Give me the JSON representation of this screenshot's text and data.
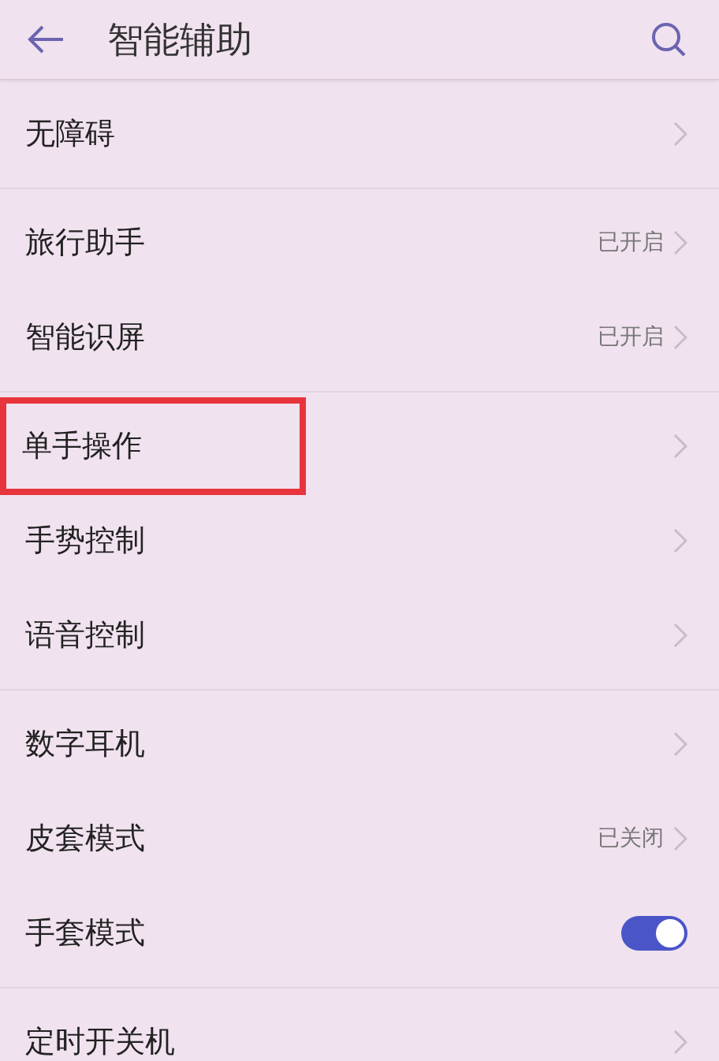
{
  "header": {
    "title": "智能辅助"
  },
  "groups": [
    {
      "items": [
        {
          "kind": "link",
          "label": "无障碍",
          "highlighted": false
        }
      ]
    },
    {
      "items": [
        {
          "kind": "link",
          "label": "旅行助手",
          "status": "已开启",
          "highlighted": false
        },
        {
          "kind": "link",
          "label": "智能识屏",
          "status": "已开启",
          "highlighted": false
        }
      ]
    },
    {
      "items": [
        {
          "kind": "link",
          "label": "单手操作",
          "highlighted": true
        },
        {
          "kind": "link",
          "label": "手势控制",
          "highlighted": false
        },
        {
          "kind": "link",
          "label": "语音控制",
          "highlighted": false
        }
      ]
    },
    {
      "items": [
        {
          "kind": "link",
          "label": "数字耳机",
          "highlighted": false
        },
        {
          "kind": "link",
          "label": "皮套模式",
          "status": "已关闭",
          "highlighted": false
        },
        {
          "kind": "toggle",
          "label": "手套模式",
          "on": true,
          "highlighted": false
        }
      ]
    },
    {
      "items": [
        {
          "kind": "link",
          "label": "定时开关机",
          "highlighted": false
        }
      ]
    }
  ]
}
